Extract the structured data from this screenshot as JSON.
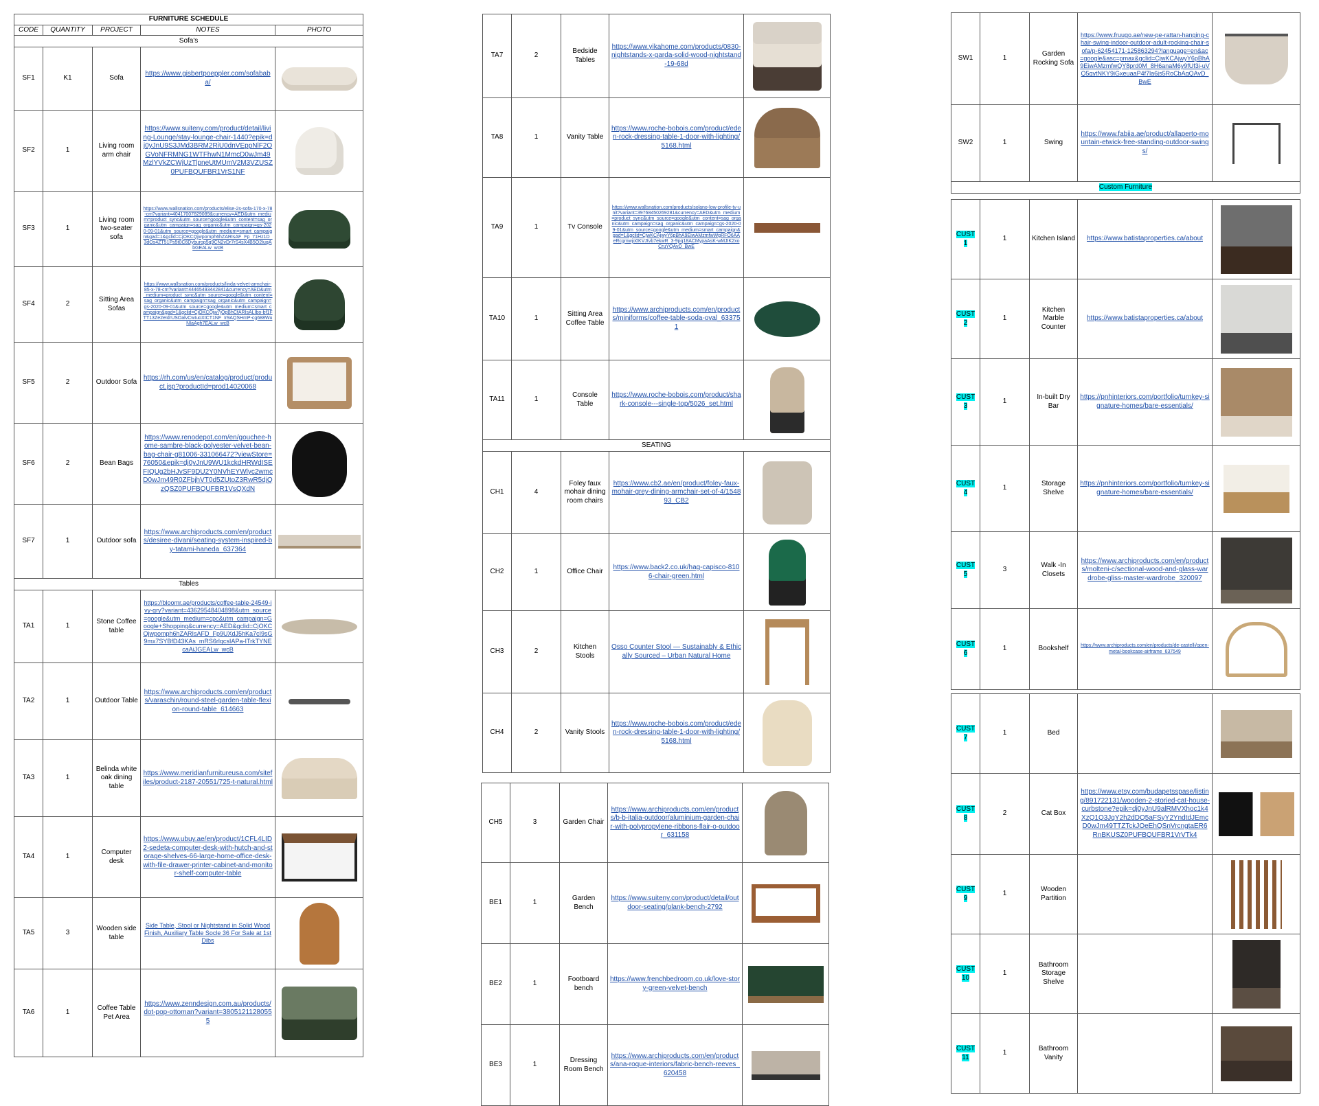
{
  "schedule": {
    "title": "FURNITURE SCHEDULE",
    "headers": [
      "CODE",
      "QUANTITY",
      "PROJECT",
      "NOTES",
      "PHOTO"
    ]
  },
  "sections": {
    "sofas": "Sofa's",
    "tables": "Tables",
    "seating": "SEATING",
    "custom": "Custom Furniture"
  },
  "col1": {
    "sofas": [
      {
        "code": "SF1",
        "qty": "K1",
        "project": "Sofa",
        "url": "https://www.gisbertpoeppler.com/sofababa/",
        "icon": "curved-sofa-photo"
      },
      {
        "code": "SF2",
        "qty": "1",
        "project": "Living room arm chair",
        "url": "https://www.suiteny.com/product/detail/living-Lounge/stay-lounge-chair-1440?epik=dj0yJnU9S3JMd3BRM2RiU0dnVEppNlF2OGVoNFRMNG1WTFhwN1MmcD0wJm49MzlYVkZCWjUzTlpneUtMUmV2M3VZUSZ0PUFBQUFBR1VrS1NF",
        "icon": "white-armchair-photo"
      },
      {
        "code": "SF3",
        "qty": "1",
        "project": "Living room two-seater sofa",
        "url": "https://www.wallsnation.com/products/elise-2s-sofa-170-x-78-cm?variant=40417007829089&currency=AED&utm_medium=product_sync&utm_source=google&utm_content=sag_organic&utm_campaign=sag_organic&utm_campaign=gs-2020-09-01&utm_source=google&utm_medium=smart_campaign&gad=1&gclid=CjOKCQjwpomph6hZARIsAF_Fp_71Hz1D_3dOs4ZT51Ps5t0C6Dyburop5q9CN2vDr7rS4sX4B5O2IuqAbGEALw_wcB",
        "icon": "green-two-seater-photo"
      },
      {
        "code": "SF4",
        "qty": "2",
        "project": "Sitting Area Sofas",
        "url": "https://www.wallsnation.com/products/linda-velvet-armchair-85-x-78-cm?variant=44465493442841&currency=AED&utm_medium=product_sync&utm_source=google&utm_content=sag_organic&utm_campaign=sag_organic&utm_campaign=gs-2020-09-01&utm_source=google&utm_medium=smart_campaign&gad=1&gclid=CjOKCQjw7jOpBhCfARIsALIbo-bf1FTT13Ze2eIdrUSOalvCwIuoXtCT1NF_Ir9AQSHmP-cg688WuNIaAgh7EALw_wcB",
        "icon": "green-armchair-photo"
      },
      {
        "code": "SF5",
        "qty": "2",
        "project": "Outdoor Sofa",
        "url": "https://rh.com/us/en/catalog/product/product.jsp?productId=prod14020068",
        "icon": "outdoor-armchair-photo"
      },
      {
        "code": "SF6",
        "qty": "2",
        "project": "Bean Bags",
        "url": "https://www.renodepot.com/en/gouchee-home-sambre-black-polyester-velvet-bean-bag-chair-g81006-331066472?viewStore=76050&epik=dj0yJnU9WU1kckdHRWdISEFIQUg2bHJvSF9DU2Y0NVhEYWlyc2wmcD0wJm49R0ZFbjhVT0d5ZUtoZ3RwR5djQzQSZ0PUFBQUFBR1VsQXdN",
        "icon": "bean-bag-photo"
      },
      {
        "code": "SF7",
        "qty": "1",
        "project": "Outdoor sofa",
        "url": "https://www.archiproducts.com/en/products/desiree-divani/seating-system-inspired-by-tatami-haneda_637364",
        "icon": "daybed-photo"
      }
    ],
    "tables": [
      {
        "code": "TA1",
        "qty": "1",
        "project": "Stone Coffee table",
        "url": "https://bloomr.ae/products/coffee-table-24549-ivy-gry?variant=43629548404898&utm_source=google&utm_medium=cpc&utm_campaign=Google+Shopping&currency=AED&gclid=CjOKCQjwpomph6hZARIsAFD_Fp9UXdJ5hKa7cI9sG9mx7SYBfD43KAs_mRS6rlqcsIAPa-ITrkTYNEcaAiJGEALw_wcB",
        "icon": "stone-table-photo"
      },
      {
        "code": "TA2",
        "qty": "1",
        "project": "Outdoor Table",
        "url": "https://www.archiproducts.com/en/products/varaschin/round-steel-garden-table-flexion-round-table_614663",
        "icon": "round-table-photo"
      },
      {
        "code": "TA3",
        "qty": "1",
        "project": "Belinda white oak dining table",
        "url": "https://www.meridianfurnitureusa.com/sitefiles/product-2187-20551/725-t-natural.html",
        "icon": "oak-dining-table-photo"
      },
      {
        "code": "TA4",
        "qty": "1",
        "project": "Computer desk",
        "url": "https://www.ubuy.ae/en/product/1CFL4LID2-sedeta-computer-desk-with-hutch-and-storage-shelves-66-large-home-office-desk-with-file-drawer-printer-cabinet-and-monitor-shelf-computer-table",
        "icon": "computer-desk-photo"
      },
      {
        "code": "TA5",
        "qty": "3",
        "project": "Wooden side table",
        "url": "Side Table, Stool or Nightstand in Solid Wood Finish, Auxiliary Table Socle 36 For Sale at 1stDibs",
        "icon": "wooden-side-table-photo"
      },
      {
        "code": "TA6",
        "qty": "1",
        "project": "Coffee Table Pet Area",
        "url": "https://www.zenndesign.com.au/products/dot-pop-ottoman?variant=38051211280555",
        "icon": "ottoman-photo"
      }
    ]
  },
  "col2": {
    "tables": [
      {
        "code": "TA7",
        "qty": "2",
        "project": "Bedside Tables",
        "url": "https://www.yikahome.com/products/0830-nightstands-x-garda-solid-wood-nightstand-19-68d",
        "icon": "nightstand-photo"
      },
      {
        "code": "TA8",
        "qty": "1",
        "project": "Vanity Table",
        "url": "https://www.roche-bobois.com/product/eden-rock-dressing-table-1-door-with-lighting/5168.html",
        "icon": "vanity-table-photo"
      },
      {
        "code": "TA9",
        "qty": "1",
        "project": "Tv Console",
        "url": "https://www.wallsnation.com/products/solano-low-profile-tv-unit?variant=39768450269281&currency=AED&utm_medium=product_sync&utm_source=google&utm_content=sag_organic&utm_campaign=sag_organic&utm_campaign=gs-2020-09-01&utm_source=google&utm_medium=smart_campaign&gad=1&gclid=CjwKCAjwyY6pBhA9EiwAMzmfwWgRFO6AAeRcgmwjo0KVJtvb7ekwR_3-9pq18ACMypaAsK-wMJIK2xoCruYQAvD_BwE",
        "icon": "tv-console-photo"
      },
      {
        "code": "TA10",
        "qty": "1",
        "project": "Sitting Area Coffee Table",
        "url": "https://www.archiproducts.com/en/products/miniforms/coffee-table-soda-oval_633751",
        "icon": "green-coffee-table-photo"
      },
      {
        "code": "TA11",
        "qty": "1",
        "project": "Console Table",
        "url": "https://www.roche-bobois.com/product/shark-console---single-top/5026_set.html",
        "icon": "console-table-photo"
      }
    ],
    "seating": [
      {
        "code": "CH1",
        "qty": "4",
        "project": "Foley faux mohair dining room chairs",
        "url": "https://www.cb2.ae/en/product/foley-faux-mohair-grey-dining-armchair-set-of-4/154893_CB2",
        "icon": "dining-chair-photo"
      },
      {
        "code": "CH2",
        "qty": "1",
        "project": "Office Chair",
        "url": "https://www.back2.co.uk/hag-capisco-8106-chair-green.html",
        "icon": "office-chair-photo"
      },
      {
        "code": "CH3",
        "qty": "2",
        "project": "Kitchen Stools",
        "url": "Osso Counter Stool — Sustainably & Ethically Sourced – Urban Natural Home",
        "icon": "kitchen-stool-photo"
      },
      {
        "code": "CH4",
        "qty": "2",
        "project": "Vanity Stools",
        "url": "https://www.roche-bobois.com/product/eden-rock-dressing-table-1-door-with-lighting/5168.html",
        "icon": "vanity-stool-photo"
      },
      {
        "code": "CH5",
        "qty": "3",
        "project": "Garden Chair",
        "url": "https://www.archiproducts.com/en/products/b-b-italia-outdoor/aluminium-garden-chair-with-polypropylene-ribbons-flair-o-outdoor_631158",
        "icon": "garden-chair-photo"
      },
      {
        "code": "BE1",
        "qty": "1",
        "project": "Garden Bench",
        "url": "https://www.suiteny.com/product/detail/outdoor-seating/plank-bench-2792",
        "icon": "garden-bench-photo"
      },
      {
        "code": "BE2",
        "qty": "1",
        "project": "Footboard bench",
        "url": "https://www.frenchbedroom.co.uk/love-story-green-velvet-bench",
        "icon": "velvet-bench-photo"
      },
      {
        "code": "BE3",
        "qty": "1",
        "project": "Dressing Room Bench",
        "url": "https://www.archiproducts.com/en/products/ana-roque-interiors/fabric-bench-reeves_620458",
        "icon": "dressing-bench-photo"
      }
    ]
  },
  "col3": {
    "swings": [
      {
        "code": "SW1",
        "qty": "1",
        "project": "Garden Rocking Sofa",
        "url": "https://www.fruugo.ae/new-pe-rattan-hanging-chair-swing-indoor-outdoor-adult-rocking-chair-sofa/p-62454171-125863294?language=en&ac=google&asc=pmax&gclid=CjwKCAjwyY6pBhA9EiwAMzmfwQY8prd0M_8H6anaM6y9fUf3i-uVQ5gytNKY9iGxeuaaP4f7la6js5RoCbAgQAvD_BwE",
        "icon": "hanging-sofa-photo"
      },
      {
        "code": "SW2",
        "qty": "1",
        "project": "Swing",
        "url": "https://www.fabiia.ae/product/allaperto-mountain-etwick-free-standing-outdoor-swings/",
        "icon": "swing-photo"
      }
    ],
    "custom": [
      {
        "code": "CUST 1",
        "qty": "1",
        "project": "Kitchen Island",
        "url": "https://www.batistaproperties.ca/about",
        "icon": "kitchen-island-photo"
      },
      {
        "code": "CUST 2",
        "qty": "1",
        "project": "Kitchen Marble Counter",
        "url": "https://www.batistaproperties.ca/about",
        "icon": "marble-counter-photo"
      },
      {
        "code": "CUST 3",
        "qty": "1",
        "project": "In-built Dry Bar",
        "url": "https://pnhinteriors.com/portfolio/turnkey-signature-homes/bare-essentials/",
        "icon": "dry-bar-photo"
      },
      {
        "code": "CUST 4",
        "qty": "1",
        "project": "Storage Shelve",
        "url": "https://pnhinteriors.com/portfolio/turnkey-signature-homes/bare-essentials/",
        "icon": "storage-shelve-photo"
      },
      {
        "code": "CUST 5",
        "qty": "3",
        "project": "Walk -In Closets",
        "url": "https://www.archiproducts.com/en/products/molteni-c/sectional-wood-and-glass-wardrobe-gliss-master-wardrobe_320097",
        "icon": "walk-in-closet-photo"
      },
      {
        "code": "CUST 6",
        "qty": "1",
        "project": "Bookshelf",
        "url": "https://www.archiproducts.com/en/products/de-castelli/open-metal-bookcase-airframe_637549",
        "icon": "bookshelf-photo"
      },
      {
        "code": "CUST 7",
        "qty": "1",
        "project": "Bed",
        "url": "",
        "icon": "bed-photo"
      },
      {
        "code": "CUST 8",
        "qty": "2",
        "project": "Cat Box",
        "url": "https://www.etsy.com/budapetsspase/listing/891722131/wooden-2-storied-cat-house-curbstone?epik=dj0yJnU9alRMVXhoc1k4XzQ1Q3JqY2h2dDQ5aFSyY2YndtdJEmcD0wJm49TTZTckJOeEhQSnVrcngtaER6RnBKUSZ0PUFBQUFBR1VrVTk4",
        "icon": "cat-box-photo"
      },
      {
        "code": "CUST 9",
        "qty": "1",
        "project": "Wooden Partition",
        "url": "",
        "icon": "wooden-partition-photo"
      },
      {
        "code": "CUST 10",
        "qty": "1",
        "project": "Bathroom Storage Shelve",
        "url": "",
        "icon": "bathroom-shelve-photo"
      },
      {
        "code": "CUST 11",
        "qty": "1",
        "project": "Bathroom Vanity",
        "url": "",
        "icon": "bathroom-vanity-photo"
      }
    ]
  }
}
